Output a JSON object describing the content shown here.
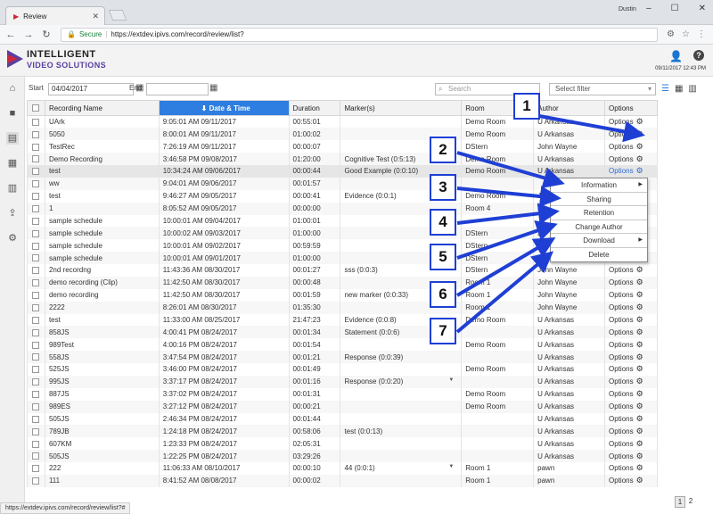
{
  "browser": {
    "tab_title": "Review",
    "window_user": "Dustin",
    "secure_label": "Secure",
    "url": "https://extdev.ipivs.com/record/review/list?",
    "status_url": "https://extdev.ipivs.com/record/review/list?#"
  },
  "header": {
    "brand_line1": "INTELLIGENT",
    "brand_line2": "VIDEO SOLUTIONS",
    "datetime": "09/11/2017 12:43 PM"
  },
  "filters": {
    "start_label": "Start",
    "start_value": "04/04/2017",
    "end_label": "End",
    "end_value": "",
    "search_placeholder": "Search",
    "select_value": "Select filter"
  },
  "table": {
    "columns": [
      "Recording Name",
      "Date & Time",
      "Duration",
      "Marker(s)",
      "Room",
      "Author",
      "Options"
    ],
    "options_label": "Options",
    "rows": [
      {
        "name": "UArk",
        "datetime": "9:05:01 AM 09/11/2017",
        "duration": "00:55:01",
        "marker": "",
        "room": "Demo Room",
        "author": "U Arkansas"
      },
      {
        "name": "5050",
        "datetime": "8:00:01 AM 09/11/2017",
        "duration": "01:00:02",
        "marker": "",
        "room": "Demo Room",
        "author": "U Arkansas"
      },
      {
        "name": "TestRec",
        "datetime": "7:26:19 AM 09/11/2017",
        "duration": "00:00:07",
        "marker": "",
        "room": "DStern",
        "author": "John Wayne"
      },
      {
        "name": "Demo Recording",
        "datetime": "3:46:58 PM 09/08/2017",
        "duration": "01:20:00",
        "marker": "Cognitive Test (0:5:13)",
        "room": "Demo Room",
        "author": "U Arkansas"
      },
      {
        "name": "test",
        "datetime": "10:34:24 AM 09/06/2017",
        "duration": "00:00:44",
        "marker": "Good Example (0:0:10)",
        "room": "Demo Room",
        "author": "U Arkansas"
      },
      {
        "name": "ww",
        "datetime": "9:04:01 AM 09/06/2017",
        "duration": "00:01:57",
        "marker": "",
        "room": "",
        "author": "",
        "hide_options": true
      },
      {
        "name": "test",
        "datetime": "9:46:27 AM 09/05/2017",
        "duration": "00:00:41",
        "marker": "Evidence (0:0:1)",
        "room": "Demo Room",
        "author": "Jo",
        "hide_options": true
      },
      {
        "name": "1",
        "datetime": "8:05:52 AM 09/05/2017",
        "duration": "00:00:00",
        "marker": "",
        "room": "Room 4",
        "author": "Jo",
        "hide_options": true
      },
      {
        "name": "sample schedule",
        "datetime": "10:00:01 AM 09/04/2017",
        "duration": "01:00:01",
        "marker": "",
        "room": "",
        "author": "Jo",
        "hide_options": true
      },
      {
        "name": "sample schedule",
        "datetime": "10:00:02 AM 09/03/2017",
        "duration": "01:00:00",
        "marker": "",
        "room": "DStern",
        "author": "Jo",
        "hide_options": true
      },
      {
        "name": "sample schedule",
        "datetime": "10:00:01 AM 09/02/2017",
        "duration": "00:59:59",
        "marker": "",
        "room": "DStern",
        "author": "Jo",
        "hide_options": true
      },
      {
        "name": "sample schedule",
        "datetime": "10:00:01 AM 09/01/2017",
        "duration": "01:00:00",
        "marker": "",
        "room": "DStern",
        "author": "Jo",
        "hide_options": true
      },
      {
        "name": "2nd recordng",
        "datetime": "11:43:36 AM 08/30/2017",
        "duration": "00:01:27",
        "marker": "sss (0:0:3)",
        "room": "DStern",
        "author": "John Wayne"
      },
      {
        "name": "demo recording (Clip)",
        "datetime": "11:42:50 AM 08/30/2017",
        "duration": "00:00:48",
        "marker": "",
        "room": "Room 1",
        "author": "John Wayne"
      },
      {
        "name": "demo recording",
        "datetime": "11:42:50 AM 08/30/2017",
        "duration": "00:01:59",
        "marker": "new marker (0:0:33)",
        "room": "Room 1",
        "author": "John Wayne"
      },
      {
        "name": "2222",
        "datetime": "8:26:01 AM 08/30/2017",
        "duration": "01:35:30",
        "marker": "",
        "room": "Room 1",
        "author": "John Wayne"
      },
      {
        "name": "test",
        "datetime": "11:33:00 AM 08/25/2017",
        "duration": "21:47:23",
        "marker": "Evidence (0:0:8)",
        "room": "Demo Room",
        "author": "U Arkansas"
      },
      {
        "name": "858JS",
        "datetime": "4:00:41 PM 08/24/2017",
        "duration": "00:01:34",
        "marker": "Statement (0:0:6)",
        "room": "",
        "author": "U Arkansas"
      },
      {
        "name": "989Test",
        "datetime": "4:00:16 PM 08/24/2017",
        "duration": "00:01:54",
        "marker": "",
        "room": "Demo Room",
        "author": "U Arkansas"
      },
      {
        "name": "558JS",
        "datetime": "3:47:54 PM 08/24/2017",
        "duration": "00:01:21",
        "marker": "Response (0:0:39)",
        "room": "",
        "author": "U Arkansas"
      },
      {
        "name": "525JS",
        "datetime": "3:46:00 PM 08/24/2017",
        "duration": "00:01:49",
        "marker": "",
        "room": "Demo Room",
        "author": "U Arkansas"
      },
      {
        "name": "995JS",
        "datetime": "3:37:17 PM 08/24/2017",
        "duration": "00:01:16",
        "marker": "Response (0:0:20)",
        "room": "",
        "author": "U Arkansas",
        "marker_dropdown": true
      },
      {
        "name": "887JS",
        "datetime": "3:37:02 PM 08/24/2017",
        "duration": "00:01:31",
        "marker": "",
        "room": "Demo Room",
        "author": "U Arkansas"
      },
      {
        "name": "989ES",
        "datetime": "3:27:12 PM 08/24/2017",
        "duration": "00:00:21",
        "marker": "",
        "room": "Demo Room",
        "author": "U Arkansas"
      },
      {
        "name": "505JS",
        "datetime": "2:46:34 PM 08/24/2017",
        "duration": "00:01:44",
        "marker": "",
        "room": "",
        "author": "U Arkansas"
      },
      {
        "name": "789JB",
        "datetime": "1:24:18 PM 08/24/2017",
        "duration": "00:58:06",
        "marker": "test (0:0:13)",
        "room": "",
        "author": "U Arkansas"
      },
      {
        "name": "607KM",
        "datetime": "1:23:33 PM 08/24/2017",
        "duration": "02:05:31",
        "marker": "",
        "room": "",
        "author": "U Arkansas"
      },
      {
        "name": "505JS",
        "datetime": "1:22:25 PM 08/24/2017",
        "duration": "03:29:26",
        "marker": "",
        "room": "",
        "author": "U Arkansas"
      },
      {
        "name": "222",
        "datetime": "11:06:33 AM 08/10/2017",
        "duration": "00:00:10",
        "marker": "44 (0:0:1)",
        "room": "Room 1",
        "author": "pawn",
        "marker_dropdown": true
      },
      {
        "name": "111",
        "datetime": "8:41:52 AM 08/08/2017",
        "duration": "00:00:02",
        "marker": "",
        "room": "Room 1",
        "author": "pawn"
      }
    ]
  },
  "context_menu": {
    "items": [
      {
        "label": "Information",
        "submenu": true
      },
      {
        "label": "Sharing",
        "submenu": false
      },
      {
        "label": "Retention",
        "submenu": false
      },
      {
        "label": "Change Author",
        "submenu": false
      },
      {
        "label": "Download",
        "submenu": true
      },
      {
        "label": "Delete",
        "submenu": false
      }
    ]
  },
  "callouts": [
    "1",
    "2",
    "3",
    "4",
    "5",
    "6",
    "7"
  ],
  "pagination": {
    "pages": [
      "1",
      "2"
    ],
    "current": "1"
  },
  "colors": {
    "accent": "#2e7de0",
    "callout_border": "#1f3fd4",
    "arrow": "#1f3fd4",
    "brand_purple": "#5a3fa0"
  },
  "icons": {
    "sidebar": [
      "home-icon",
      "video-camera-icon",
      "film-icon",
      "calendar-icon",
      "bar-chart-icon",
      "upload-icon",
      "gear-icon"
    ],
    "header": [
      "user-icon",
      "help-icon"
    ]
  }
}
